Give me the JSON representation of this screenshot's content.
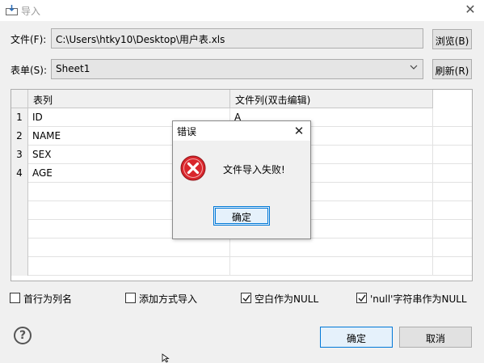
{
  "window": {
    "title": "导入",
    "close_glyph": "✕"
  },
  "file": {
    "label": "文件(F):",
    "path": "C:\\Users\\htky10\\Desktop\\用户表.xls",
    "browse_label": "浏览(B)"
  },
  "sheet": {
    "label": "表单(S):",
    "selected": "Sheet1",
    "refresh_label": "刷新(R)"
  },
  "grid": {
    "headers": [
      "表列",
      "文件列(双击编辑)"
    ],
    "rows": [
      {
        "num": "1",
        "col": "ID",
        "file_col": "A"
      },
      {
        "num": "2",
        "col": "NAME",
        "file_col": ""
      },
      {
        "num": "3",
        "col": "SEX",
        "file_col": ""
      },
      {
        "num": "4",
        "col": "AGE",
        "file_col": ""
      }
    ]
  },
  "options": [
    {
      "label": "首行为列名",
      "checked": false
    },
    {
      "label": "添加方式导入",
      "checked": false
    },
    {
      "label": "空白作为NULL",
      "checked": true
    },
    {
      "label": "'null'字符串作为NULL",
      "checked": true
    }
  ],
  "footer": {
    "help_glyph": "?",
    "ok_label": "确定",
    "cancel_label": "取消"
  },
  "error_dialog": {
    "title": "错误",
    "message": "文件导入失败!",
    "ok_label": "确定",
    "close_glyph": "✕"
  },
  "colors": {
    "accent": "#0078d7",
    "error_red": "#d9262c"
  }
}
